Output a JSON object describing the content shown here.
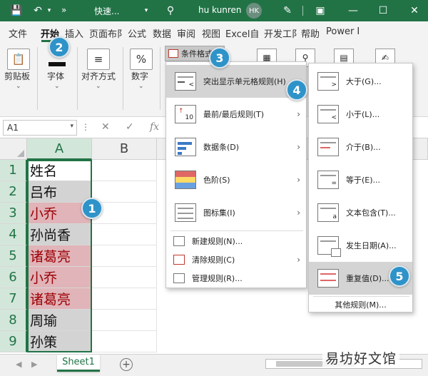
{
  "titlebar": {
    "quick_access": "快速...",
    "user_name": "hu kunren",
    "user_initials": "HK",
    "more_glyph": "»"
  },
  "ribbon_tabs": [
    "文件",
    "开始",
    "插入",
    "页面布⻖",
    "公式",
    "数据",
    "审阅",
    "视图",
    "Excel自",
    "开发工⻖",
    "帮助",
    "Power I"
  ],
  "active_tab_index": 1,
  "ribbon_groups": [
    {
      "label": "剪贴板"
    },
    {
      "label": "字体"
    },
    {
      "label": "对齐方式"
    },
    {
      "label": "数字",
      "icon": "%"
    }
  ],
  "conditional_format_button": "条件格式",
  "formula_bar": {
    "name_box": "A1",
    "fx": "fx"
  },
  "grid": {
    "columns": [
      "A",
      "B"
    ],
    "rows": [
      {
        "num": "1",
        "value": "姓名",
        "style": "first"
      },
      {
        "num": "2",
        "value": "吕布",
        "style": "sel"
      },
      {
        "num": "3",
        "value": "小乔",
        "style": "dup"
      },
      {
        "num": "4",
        "value": "孙尚香",
        "style": "sel"
      },
      {
        "num": "5",
        "value": "诸葛亮",
        "style": "dup"
      },
      {
        "num": "6",
        "value": "小乔",
        "style": "dup"
      },
      {
        "num": "7",
        "value": "诸葛亮",
        "style": "dup"
      },
      {
        "num": "8",
        "value": "周瑜",
        "style": "sel"
      },
      {
        "num": "9",
        "value": "孙策",
        "style": "sel"
      }
    ]
  },
  "sheet_tab": "Sheet1",
  "watermark": "易坊好文馆",
  "main_menu": {
    "items": [
      {
        "label": "突出显示单元格规则(H)",
        "has_submenu": true,
        "highlighted": true
      },
      {
        "label": "最前/最后规则(T)",
        "has_submenu": true
      },
      {
        "label": "数据条(D)",
        "has_submenu": true
      },
      {
        "label": "色阶(S)",
        "has_submenu": true
      },
      {
        "label": "图标集(I)",
        "has_submenu": true
      }
    ],
    "small_items": [
      {
        "label": "新建规则(N)...",
        "has_submenu": false
      },
      {
        "label": "清除规则(C)",
        "has_submenu": true
      },
      {
        "label": "管理规则(R)...",
        "has_submenu": false
      }
    ]
  },
  "sub_menu": {
    "items": [
      {
        "label": "大于(G)..."
      },
      {
        "label": "小于(L)..."
      },
      {
        "label": "介于(B)..."
      },
      {
        "label": "等于(E)..."
      },
      {
        "label": "文本包含(T)..."
      },
      {
        "label": "发生日期(A)..."
      },
      {
        "label": "重复值(D)...",
        "highlighted": true
      }
    ],
    "footer": "其他规则(M)..."
  },
  "badges": [
    "1",
    "2",
    "3",
    "4",
    "5"
  ],
  "colors": {
    "excel_green": "#217346",
    "duplicate_fill": "#e0b4b8",
    "duplicate_text": "#9c0006",
    "badge_blue": "#2e93c9"
  }
}
